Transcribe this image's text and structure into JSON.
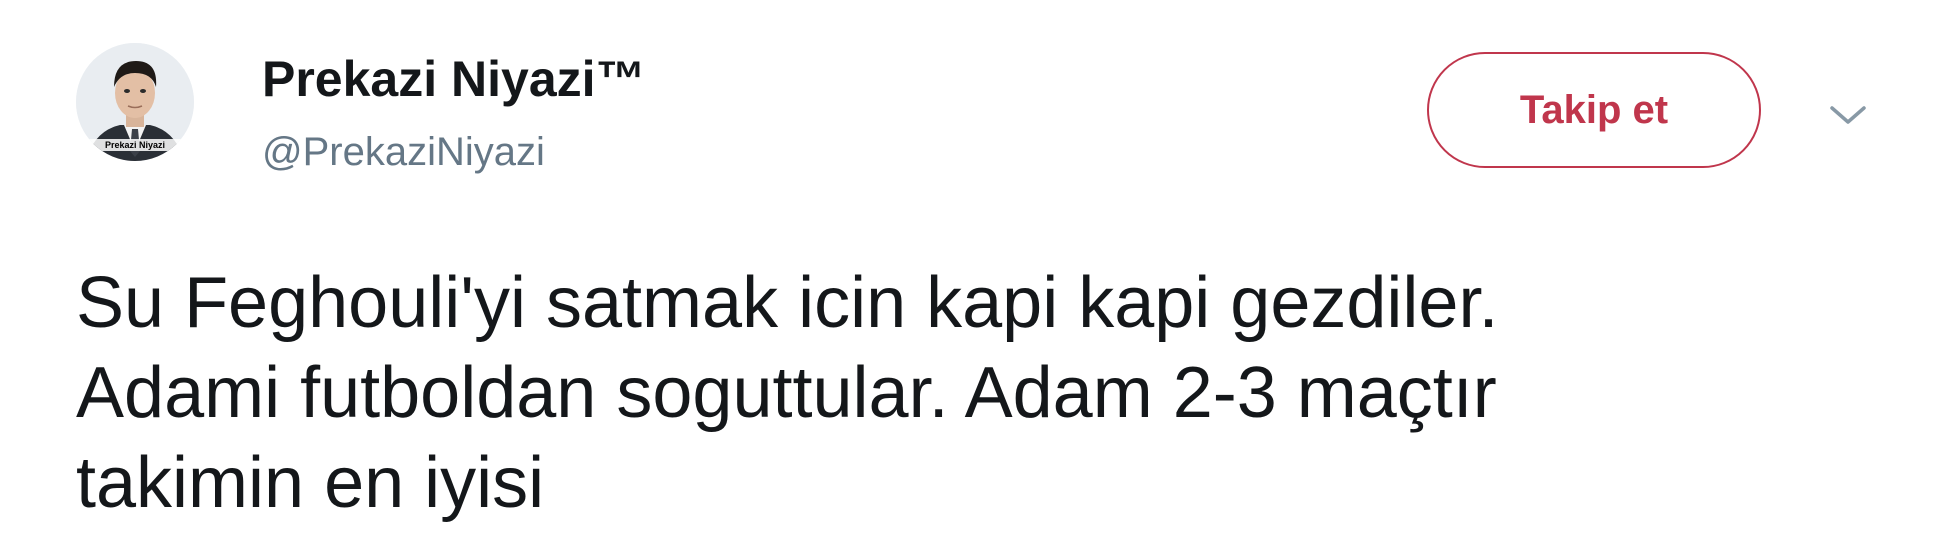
{
  "author": {
    "display_name": "Prekazi Niyazi™",
    "handle": "@PrekaziNiyazi",
    "avatar_caption": "Prekazi Niyazi"
  },
  "actions": {
    "follow_label": "Takip et",
    "menu_icon": "chevron-down-icon"
  },
  "tweet": {
    "lines": [
      "Su Feghouli'yi satmak icin kapi kapi gezdiler.",
      "Adami futboldan soguttular. Adam 2-3 maçtır",
      "takimin en iyisi"
    ]
  },
  "colors": {
    "accent": "#c0364c",
    "text": "#14171a",
    "muted": "#657786"
  }
}
